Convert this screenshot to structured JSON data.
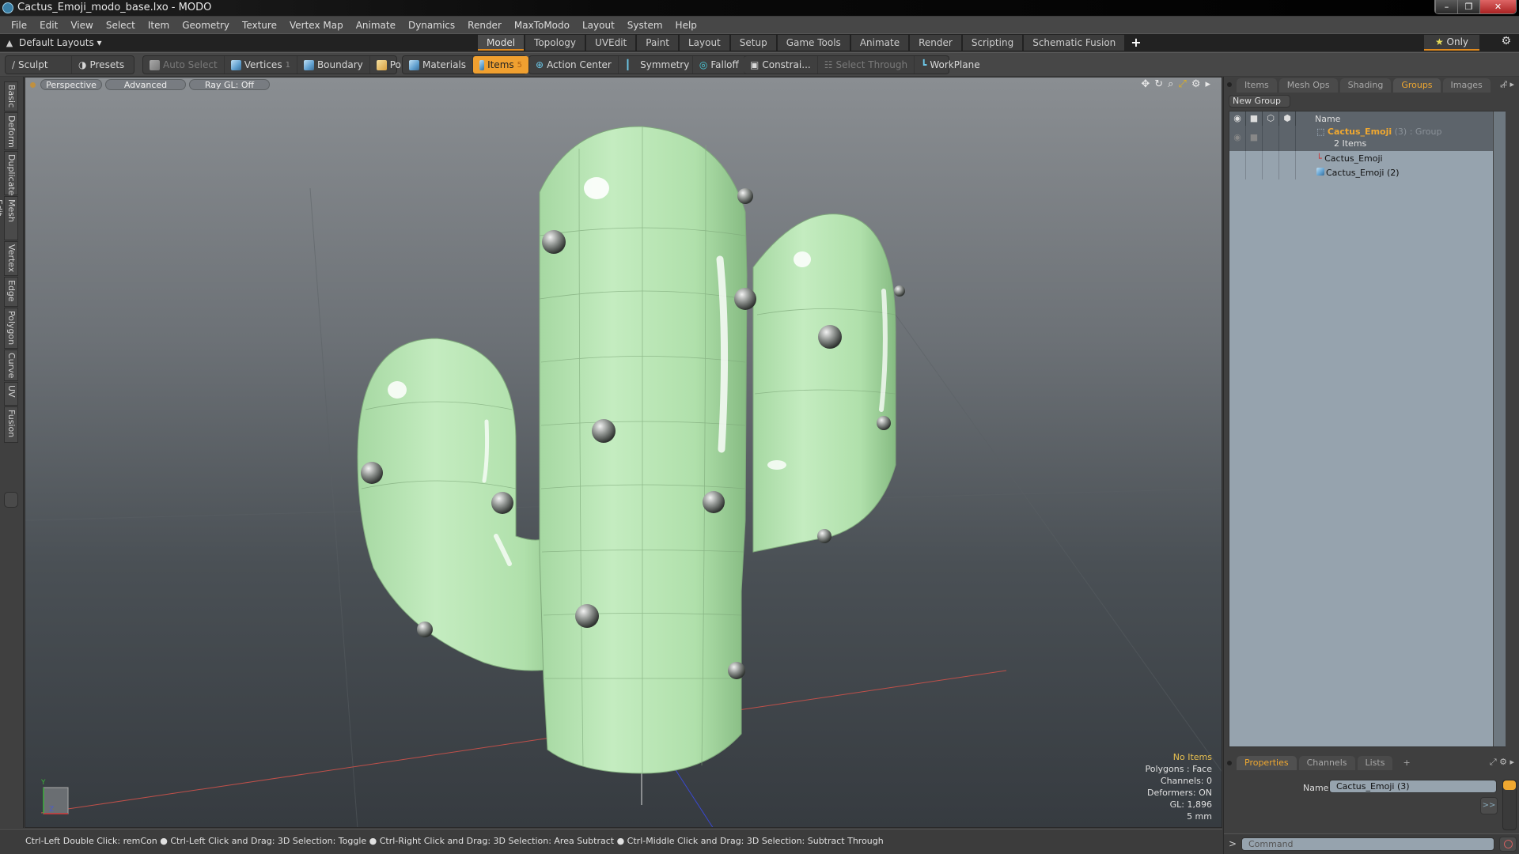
{
  "window": {
    "title": "Cactus_Emoji_modo_base.lxo - MODO",
    "controls": [
      "minimize",
      "restore",
      "close"
    ]
  },
  "menu": [
    "File",
    "Edit",
    "View",
    "Select",
    "Item",
    "Geometry",
    "Texture",
    "Vertex Map",
    "Animate",
    "Dynamics",
    "Render",
    "MaxToModo",
    "Layout",
    "System",
    "Help"
  ],
  "layoutbar": {
    "layouts_label": "Default Layouts ▾",
    "tabs": [
      "Model",
      "Topology",
      "UVEdit",
      "Paint",
      "Layout",
      "Setup",
      "Game Tools",
      "Animate",
      "Render",
      "Scripting",
      "Schematic Fusion"
    ],
    "active_tab": "Model",
    "add_tab": "+",
    "only_label": "Only"
  },
  "toolbar": {
    "sculpt": "Sculpt",
    "presets": "Presets",
    "auto_select": "Auto Select",
    "vertices": "Vertices",
    "vertices_count": "1",
    "boundary": "Boundary",
    "polygons": "Polygons",
    "materials": "Materials",
    "items": "Items",
    "items_count": "5",
    "action_center": "Action Center",
    "symmetry": "Symmetry",
    "falloff": "Falloff",
    "constraints": "Constrai...",
    "select_through": "Select Through",
    "workplane": "WorkPlane"
  },
  "left_tabs": [
    "Basic",
    "Deform",
    "Duplicate",
    "Mesh Edit",
    "Vertex",
    "Edge",
    "Polygon",
    "Curve",
    "UV",
    "Fusion"
  ],
  "viewport": {
    "view": "Perspective",
    "shading": "Advanced",
    "raygl": "Ray GL: Off",
    "icons": [
      "move-view-icon",
      "rotate-view-icon",
      "zoom-view-icon",
      "maximize-view-icon",
      "settings-icon",
      "expand-arrow-icon"
    ],
    "info": {
      "selection": "No Items",
      "polygons": "Polygons : Face",
      "channels": "Channels: 0",
      "deformers": "Deformers: ON",
      "gl": "GL: 1,896",
      "units": "5 mm"
    },
    "colors": {
      "cactus": "#b3e3ae",
      "spine": "#9a9d9a",
      "grid_x_axis": "#c0504a"
    }
  },
  "status": "Ctrl-Left Double Click: remCon ● Ctrl-Left Click and Drag: 3D Selection: Toggle ● Ctrl-Right Click and Drag: 3D Selection: Area Subtract ● Ctrl-Middle Click and Drag: 3D Selection: Subtract Through",
  "right_panel": {
    "tabs": [
      "Items",
      "Mesh Ops",
      "Shading",
      "Groups",
      "Images"
    ],
    "active_tab": "Groups",
    "add": "+",
    "new_group": "New Group",
    "columns": {
      "name": "Name"
    },
    "group": {
      "name": "Cactus_Emoji",
      "count": "(3)",
      "type": ": Group",
      "items": "2 Items"
    },
    "children": [
      "Cactus_Emoji",
      "Cactus_Emoji (2)"
    ],
    "bottom_tabs": [
      "Properties",
      "Channels",
      "Lists"
    ],
    "bottom_active": "Properties",
    "name_label": "Name",
    "name_value": "Cactus_Emoji (3)",
    "more": ">>",
    "command_caret": ">",
    "command_placeholder": "Command"
  }
}
